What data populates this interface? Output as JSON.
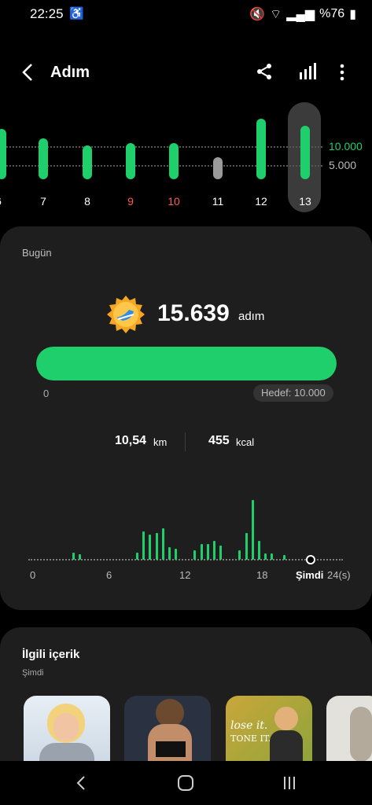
{
  "status_bar": {
    "time": "22:25",
    "battery_text": "%76"
  },
  "header": {
    "title": "Adım"
  },
  "weekly": {
    "goal_high": "10.000",
    "goal_low": "5.000",
    "days": [
      {
        "label": "6",
        "color": "#fff"
      },
      {
        "label": "7",
        "color": "#fff"
      },
      {
        "label": "8",
        "color": "#fff"
      },
      {
        "label": "9",
        "color": "#ff5a5a"
      },
      {
        "label": "10",
        "color": "#ff5a5a"
      },
      {
        "label": "11",
        "color": "#fff"
      },
      {
        "label": "12",
        "color": "#fff"
      },
      {
        "label": "13",
        "color": "#fff"
      }
    ]
  },
  "today": {
    "label": "Bugün",
    "steps": "15.639",
    "steps_unit": "adım",
    "progress": 1.0,
    "progress_start": "0",
    "goal_text": "Hedef: 10.000",
    "distance_value": "10,54",
    "distance_unit": "km",
    "calories_value": "455",
    "calories_unit": "kcal",
    "hourly_axis": [
      "0",
      "6",
      "12",
      "18",
      "Şimdi",
      "24(s)"
    ]
  },
  "related": {
    "title": "İlgili içerik",
    "subtitle": "Şimdi"
  },
  "colors": {
    "accent": "#1fcf6b",
    "background": "#000000",
    "card": "#1e1e1e",
    "weekend": "#ff5a5a"
  }
}
